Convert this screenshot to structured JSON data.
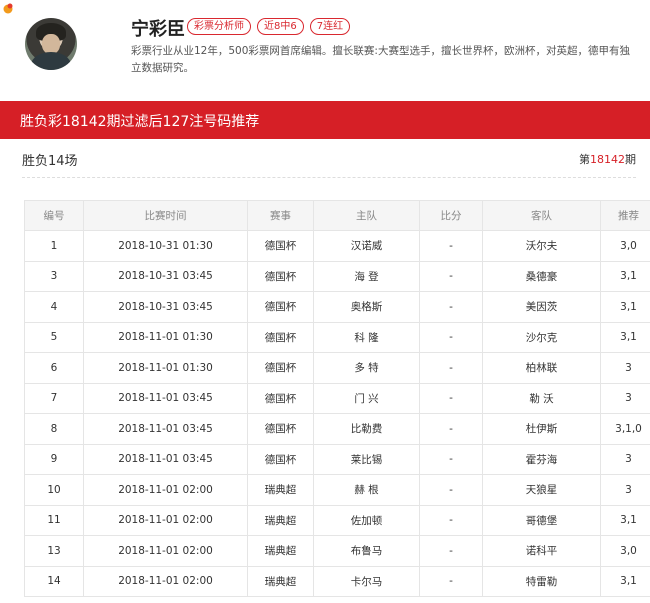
{
  "author": {
    "name": "宁彩臣",
    "tags": [
      "彩票分析师",
      "近8中6",
      "7连红"
    ],
    "bio": "彩票行业从业12年，500彩票网首席编辑。擅长联赛:大赛型选手，擅长世界杯，欧洲杯，对英超，德甲有独立数据研究。"
  },
  "banner": {
    "title": "胜负彩18142期过滤后127注号码推荐"
  },
  "section": {
    "title": "胜负14场",
    "issue_prefix": "第",
    "issue_number": "18142",
    "issue_suffix": "期"
  },
  "table": {
    "headers": [
      "编号",
      "比赛时间",
      "赛事",
      "主队",
      "比分",
      "客队",
      "推荐"
    ],
    "rows": [
      [
        "1",
        "2018-10-31 01:30",
        "德国杯",
        "汉诺威",
        "-",
        "沃尔夫",
        "3,0"
      ],
      [
        "3",
        "2018-10-31 03:45",
        "德国杯",
        "海 登",
        "-",
        "桑德豪",
        "3,1"
      ],
      [
        "4",
        "2018-10-31 03:45",
        "德国杯",
        "奥格斯",
        "-",
        "美因茨",
        "3,1"
      ],
      [
        "5",
        "2018-11-01 01:30",
        "德国杯",
        "科 隆",
        "-",
        "沙尔克",
        "3,1"
      ],
      [
        "6",
        "2018-11-01 01:30",
        "德国杯",
        "多 特",
        "-",
        "柏林联",
        "3"
      ],
      [
        "7",
        "2018-11-01 03:45",
        "德国杯",
        "门 兴",
        "-",
        "勒 沃",
        "3"
      ],
      [
        "8",
        "2018-11-01 03:45",
        "德国杯",
        "比勒费",
        "-",
        "杜伊斯",
        "3,1,0"
      ],
      [
        "9",
        "2018-11-01 03:45",
        "德国杯",
        "莱比锡",
        "-",
        "霍芬海",
        "3"
      ],
      [
        "10",
        "2018-11-01 02:00",
        "瑞典超",
        "赫 根",
        "-",
        "天狼星",
        "3"
      ],
      [
        "11",
        "2018-11-01 02:00",
        "瑞典超",
        "佐加顿",
        "-",
        "哥德堡",
        "3,1"
      ],
      [
        "13",
        "2018-11-01 02:00",
        "瑞典超",
        "布鲁马",
        "-",
        "诺科平",
        "3,0"
      ],
      [
        "14",
        "2018-11-01 02:00",
        "瑞典超",
        "卡尔马",
        "-",
        "特雷勒",
        "3,1"
      ]
    ]
  },
  "colors": {
    "accent": "#d61f26",
    "header_bg": "#f5f5f5",
    "border": "#e5e5e5"
  },
  "icons": {
    "logo": "site-logo-icon"
  }
}
